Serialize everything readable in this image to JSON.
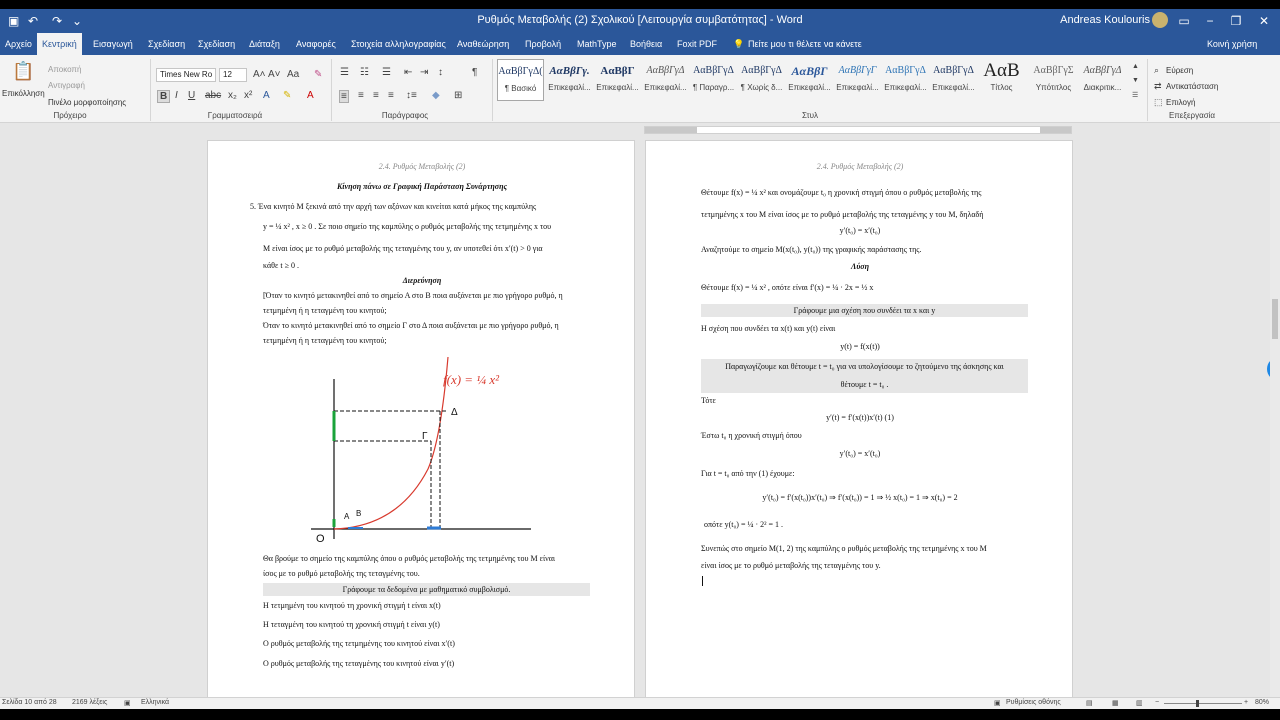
{
  "window": {
    "title": "Ρυθμός Μεταβολής (2) Σχολικού [Λειτουργία συμβατότητας] - Word",
    "user": "Andreas Koulouris",
    "minimize": "−",
    "restore": "❐",
    "close": "✕"
  },
  "tabs": [
    "Αρχείο",
    "Κεντρική",
    "Εισαγωγή",
    "Σχεδίαση",
    "Σχεδίαση",
    "Διάταξη",
    "Αναφορές",
    "Στοιχεία αλληλογραφίας",
    "Αναθεώρηση",
    "Προβολή",
    "MathType",
    "Βοήθεια",
    "Foxit PDF"
  ],
  "tell_me": "Πείτε μου τι θέλετε να κάνετε",
  "share": "Κοινή χρήση",
  "ribbon": {
    "paste": "Επικόλληση",
    "cut": "Αποκοπή",
    "copy": "Αντιγραφή",
    "format_painter": "Πινέλο μορφοποίησης",
    "clipboard_label": "Πρόχειρο",
    "font_name": "Times New Ro",
    "font_size": "12",
    "font_label": "Γραμματοσειρά",
    "paragraph_label": "Παράγραφος",
    "styles_label": "Στυλ",
    "editing_label": "Επεξεργασία",
    "find": "Εύρεση",
    "replace": "Αντικατάσταση",
    "select": "Επιλογή",
    "styles": [
      {
        "sample": "ΑαΒβΓγΔ(",
        "name": "¶ Βασικό"
      },
      {
        "sample": "ΑαΒβΓγ.",
        "name": "Επικεφαλί..."
      },
      {
        "sample": "ΑαΒβΓ",
        "name": "Επικεφαλί..."
      },
      {
        "sample": "ΑαΒβΓγΔ",
        "name": "Επικεφαλί..."
      },
      {
        "sample": "ΑαΒβΓγΔ",
        "name": "¶ Παραγρ..."
      },
      {
        "sample": "ΑαΒβΓγΔ",
        "name": "¶ Χωρίς δ..."
      },
      {
        "sample": "ΑαΒβΓ",
        "name": "Επικεφαλί..."
      },
      {
        "sample": "ΑαΒβΓγΓ",
        "name": "Επικεφαλί..."
      },
      {
        "sample": "ΑαΒβΓγΔ",
        "name": "Επικεφαλί..."
      },
      {
        "sample": "ΑαΒβΓγΔ",
        "name": "Επικεφαλί..."
      },
      {
        "sample": "ΑαΒ",
        "name": "Τίτλος"
      },
      {
        "sample": "ΑαΒβΓγΣ",
        "name": "Υπότιτλος"
      },
      {
        "sample": "ΑαΒβΓγΔ",
        "name": "Διακριτικ..."
      }
    ]
  },
  "page_left": {
    "header": "2.4. Ρυθμός Μεταβολής (2)",
    "title": "Κίνηση πάνω σε Γραφική Παράσταση Συνάρτησης",
    "lines": [
      "5.  Ένα κινητό Μ ξεκινά από την αρχή των αξόνων και κινείται κατά μήκος της καμπύλης",
      "y = ¼ x² ,  x ≥ 0 . Σε ποιο σημείο της καμπύλης ο ρυθμός μεταβολής της τετμημένης x του",
      "Μ είναι ίσος με το ρυθμό μεταβολής της τεταγμένης του y, αν υποτεθεί ότι  x′(t) > 0  για",
      "κάθε  t ≥ 0 ."
    ],
    "investigation_title": "Διερεύνηση",
    "investigation": [
      "[Όταν το κινητό μετακινηθεί από το σημείο Α στο Β ποια αυξάνεται με πιο γρήγορο ρυθμό, η",
      "τετμημένη ή η τεταγμένη του κινητού;",
      "Όταν το κινητό μετακινηθεί από το σημείο Γ στο Δ ποια αυξάνεται με πιο γρήγορο ρυθμό, η",
      "τετμημένη ή η τεταγμένη του κινητού;"
    ],
    "graph": {
      "formula": "f(x) = ¼ x²",
      "label_a": "Α",
      "label_b": "Β",
      "label_g": "Γ",
      "label_d": "Δ",
      "label_o": "O"
    },
    "bottom": [
      "Θα βρούμε το σημείο της καμπύλης όπου ο ρυθμός μεταβολής της τετμημένης  του Μ είναι",
      "ίσος με το ρυθμό μεταβολής της τεταγμένης του."
    ],
    "shaded": "Γράφουμε τα δεδομένα με μαθηματικό συμβολισμό.",
    "defs": [
      "Η τετμημένη του κινητού τη χρονική στιγμή t είναι x(t)",
      "Η τεταγμένη του κινητού τη χρονική στιγμή t είναι y(t)",
      "Ο ρυθμός μεταβολής της τετμημένης του κινητού είναι x′(t)",
      "Ο ρυθμός μεταβολής της τεταγμένης του κινητού είναι y′(t)"
    ]
  },
  "page_right": {
    "header": "2.4. Ρυθμός Μεταβολής (2)",
    "lines": [
      "Θέτουμε  f(x) = ¼ x²  και ονομάζουμε t₀ η χρονική στιγμή όπου ο ρυθμός μεταβολής της",
      "τετμημένης x του Μ είναι ίσος με το ρυθμό μεταβολής της τεταγμένης y του Μ, δηλαδή",
      "y′(t₀) = x′(t₀)",
      "Αναζητούμε το σημείο  Μ(x(t₀), y(t₀))  της γραφικής παράστασης της.",
      "Λύση",
      "Θέτουμε  f(x) = ¼ x² , οπότε είναι  f′(x) = ¼ · 2x = ½ x"
    ],
    "shaded1": "Γράφουμε μια σχέση που συνδέει τα  x  και  y",
    "relation_text": "Η σχέση που συνδέει τα  x(t)  και  y(t)  είναι",
    "relation_eq": "y(t) = f(x(t))",
    "shaded2_a": "Παραγωγίζουμε και θέτουμε  t = t₀  για να υπολογίσουμε το ζητούμενο της άσκησης και",
    "shaded2_b": "θέτουμε  t = t₀ .",
    "tote": "Τότε",
    "eq1": "y′(t) = f′(x(t))x′(t)     (1)",
    "esto": "Έστω  t₀  η χρονική στιγμή όπου",
    "eq2": "y′(t₀) = x′(t₀)",
    "gia": "Για  t = t₀  από την (1) έχουμε:",
    "eq3": "y′(t₀) = f′(x(t₀))x′(t₀)  ⇒  f′(x(t₀)) = 1 ⇒ ½ x(t₀) = 1 ⇒ x(t₀) = 2",
    "eq4": "οπότε  y(t₀) = ¼ · 2² = 1 .",
    "concl1": "Συνεπώς στο σημείο  Μ(1, 2)  της καμπύλης ο ρυθμός μεταβολής της τετμημένης x του Μ",
    "concl2": "είναι ίσος με το ρυθμό μεταβολής της τεταγμένης του y."
  },
  "status": {
    "page": "Σελίδα 10 από 28",
    "words": "2169 λέξεις",
    "lang": "Ελληνικά",
    "display": "Ρυθμίσεις οθόνης",
    "zoom": "80%"
  }
}
